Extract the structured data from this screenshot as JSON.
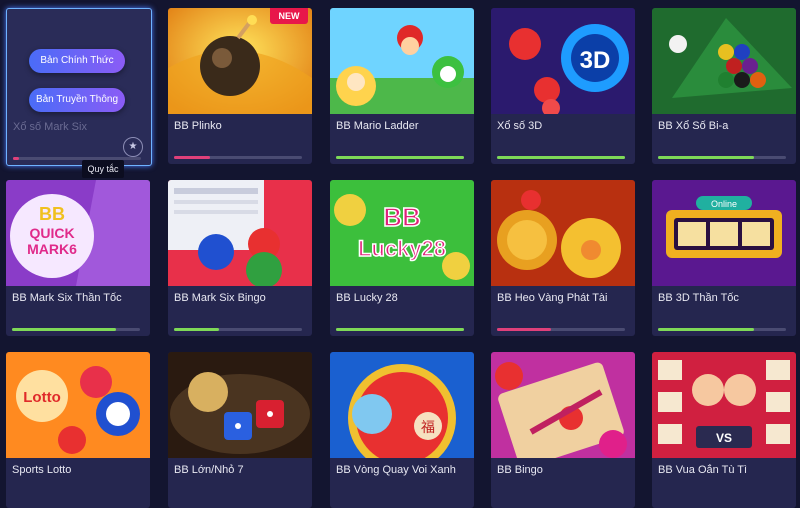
{
  "featured": {
    "title": "Xổ số Mark Six",
    "btn_official": "Bản Chính Thức",
    "btn_traditional": "Bản Truyền Thông",
    "tooltip": "Quy tắc",
    "star_icon": "★",
    "progress": 0.05
  },
  "games": [
    {
      "title": "BB Plinko",
      "badge": "NEW",
      "progress": 0.28,
      "bar_color": "#e0407a"
    },
    {
      "title": "BB Mario Ladder",
      "progress": 1.0,
      "bar_color": "#7ed957"
    },
    {
      "title": "Xổ số 3D",
      "progress": 1.0,
      "bar_color": "#7ed957"
    },
    {
      "title": "BB Xổ Số Bi-a",
      "progress": 0.75,
      "bar_color": "#7ed957"
    },
    {
      "title": "BB Mark Six Thần Tốc",
      "progress": 0.8,
      "bar_color": "#7ed957"
    },
    {
      "title": "BB Mark Six Bingo",
      "progress": 0.35,
      "bar_color": "#7ed957"
    },
    {
      "title": "BB Lucky 28",
      "progress": 1.0,
      "bar_color": "#7ed957"
    },
    {
      "title": "BB Heo Vàng Phát Tài",
      "progress": 0.42,
      "bar_color": "#e0407a"
    },
    {
      "title": "BB 3D Thần Tốc",
      "progress": 0.75,
      "bar_color": "#7ed957"
    },
    {
      "title": "Sports Lotto",
      "progress": 1.0,
      "bar_color": "#7ed957"
    },
    {
      "title": "BB Lớn/Nhỏ 7",
      "progress": 1.0,
      "bar_color": "#7ed957"
    },
    {
      "title": "BB Vòng Quay Voi Xanh",
      "progress": 1.0,
      "bar_color": "#7ed957"
    },
    {
      "title": "BB Bingo",
      "progress": 1.0,
      "bar_color": "#7ed957"
    },
    {
      "title": "BB Vua Oẳn Tù Tì",
      "progress": 1.0,
      "bar_color": "#7ed957"
    }
  ],
  "art_text": {
    "quick_mark6_top": "BB",
    "quick_mark6_mid": "QUICK",
    "quick_mark6_bot": "MARK6",
    "lucky28_a": "BB",
    "lucky28_b": "Lucky28",
    "lotto": "Lotto",
    "three_d": "3D",
    "online": "Online",
    "vs": "VS",
    "fu": "福"
  },
  "icons": {
    "star": "star-icon",
    "new": "new-badge"
  }
}
